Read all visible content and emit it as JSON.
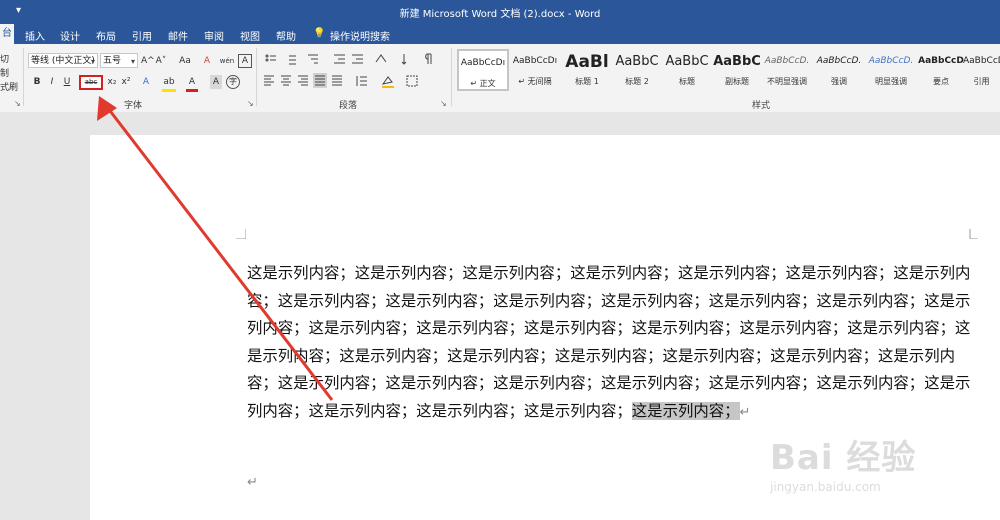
{
  "titlebar": {
    "title": "新建 Microsoft Word 文档 (2).docx  -  Word",
    "quick_access": "▾"
  },
  "tabs": {
    "home": "台",
    "insert": "插入",
    "design": "设计",
    "layout": "布局",
    "references": "引用",
    "mailings": "邮件",
    "review": "审阅",
    "view": "视图",
    "help": "帮助",
    "tell_me": "操作说明搜索"
  },
  "clipboard_stub": [
    "切",
    "制",
    "式刷"
  ],
  "font": {
    "font_name": "等线 (中文正文)",
    "font_size": "五号",
    "grow": "A^",
    "shrink": "A˅",
    "change_case": "Aa",
    "clear_format": "A",
    "phonetic": "wén",
    "char_border": "A",
    "bold": "B",
    "italic": "I",
    "underline": "U",
    "strikethrough": "abc",
    "subscript": "x₂",
    "superscript": "x²",
    "text_effects": "A",
    "highlight": "ab",
    "font_color": "A",
    "char_shading": "A",
    "enclose": "字",
    "group_label": "字体"
  },
  "paragraph": {
    "group_label": "段落"
  },
  "styles": {
    "group_label": "样式",
    "items": [
      {
        "sample": "AaBbCcDı",
        "name": "↵ 正文"
      },
      {
        "sample": "AaBbCcDı",
        "name": "↵ 无间隔"
      },
      {
        "sample": "AaBl",
        "name": "标题 1"
      },
      {
        "sample": "AaBbC",
        "name": "标题 2"
      },
      {
        "sample": "AaBbC",
        "name": "标题"
      },
      {
        "sample": "AaBbC",
        "name": "副标题"
      },
      {
        "sample": "AaBbCcD.",
        "name": "不明显强调"
      },
      {
        "sample": "AaBbCcD.",
        "name": "强调"
      },
      {
        "sample": "AaBbCcD.",
        "name": "明显强调"
      },
      {
        "sample": "AaBbCcD",
        "name": "要点"
      },
      {
        "sample": "AaBbCcD",
        "name": "引用"
      }
    ]
  },
  "document": {
    "body": "这是示列内容；这是示列内容；这是示列内容；这是示列内容；这是示列内容；这是示列内容；这是示列内容；这是示列内容；这是示列内容；这是示列内容；这是示列内容；这是示列内容；这是示列内容；这是示列内容；这是示列内容；这是示列内容；这是示列内容；这是示列内容；这是示列内容；这是示列内容；这是示列内容；这是示列内容；这是示列内容；这是示列内容；这是示列内容；这是示列内容；这是示列内容；这是示列内容；这是示列内容；这是示列内容；这是示列内容；这是示列内容；这是示列内容；这是示列内容；这是示列内容；这是示列内容；这是示列内容；",
    "selected": "这是示列内容；",
    "para_mark": "↵",
    "empty_para_mark": "↵"
  },
  "watermark": {
    "main": "Bai 经验",
    "sub": "jingyan.baidu.com"
  },
  "colors": {
    "title_bar": "#2b579a",
    "annotation": "#e03a2f"
  }
}
